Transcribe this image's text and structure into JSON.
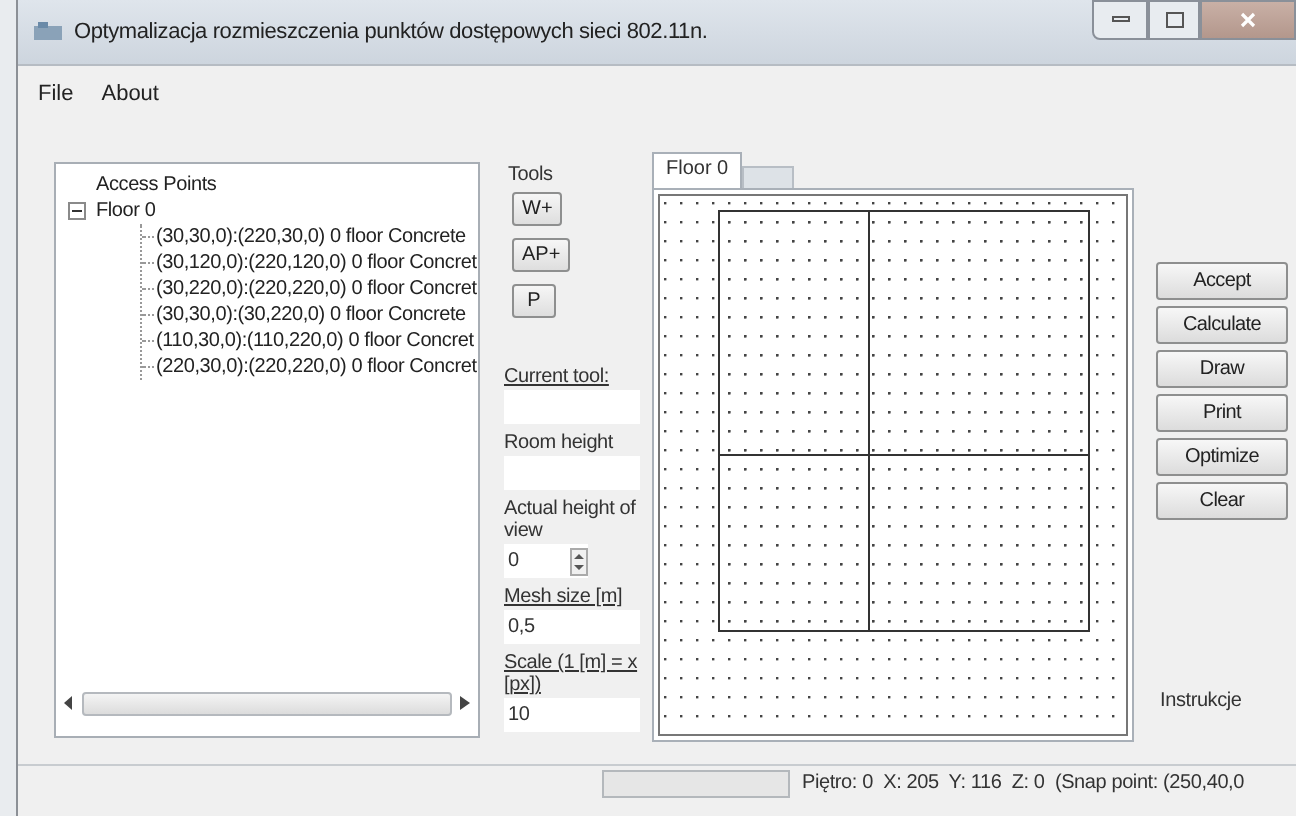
{
  "window": {
    "title": "Optymalizacja rozmieszczenia punktów dostępowych sieci 802.11n."
  },
  "menu": [
    "File",
    "About"
  ],
  "tree": {
    "items": [
      {
        "label": "Access Points"
      },
      {
        "label": "Floor 0",
        "expanded": true,
        "children": [
          {
            "label": "(30,30,0):(220,30,0) 0 floor Concrete"
          },
          {
            "label": "(30,120,0):(220,120,0) 0 floor Concret"
          },
          {
            "label": "(30,220,0):(220,220,0) 0 floor Concret"
          },
          {
            "label": "(30,30,0):(30,220,0) 0 floor Concrete"
          },
          {
            "label": "(110,30,0):(110,220,0) 0 floor Concret"
          },
          {
            "label": "(220,30,0):(220,220,0) 0 floor Concret"
          }
        ]
      }
    ]
  },
  "tools": {
    "title": "Tools",
    "buttons": [
      "W+",
      "AP+",
      "P"
    ],
    "fields": [
      {
        "kind": "text",
        "label": "Current tool:",
        "underlined": true
      },
      {
        "kind": "text",
        "label": "Room height",
        "underlined": false
      },
      {
        "kind": "spin",
        "label": "Actual height of view",
        "underlined": false,
        "value": "0"
      },
      {
        "kind": "text",
        "label": "Mesh size [m]",
        "underlined": true,
        "value": "0,5"
      },
      {
        "kind": "text",
        "label": "Scale (1 [m] = x [px])",
        "underlined": true,
        "value": "10"
      }
    ]
  },
  "tabs": [
    {
      "label": "Floor 0",
      "selected": true
    }
  ],
  "actions": [
    "Accept",
    "Calculate",
    "Draw",
    "Print",
    "Optimize",
    "Clear"
  ],
  "instructions": "Instrukcje",
  "status_bar": {
    "text": "Piętro: 0  X: 205  Y: 116  Z: 0  (Snap point: (250,40,0"
  }
}
